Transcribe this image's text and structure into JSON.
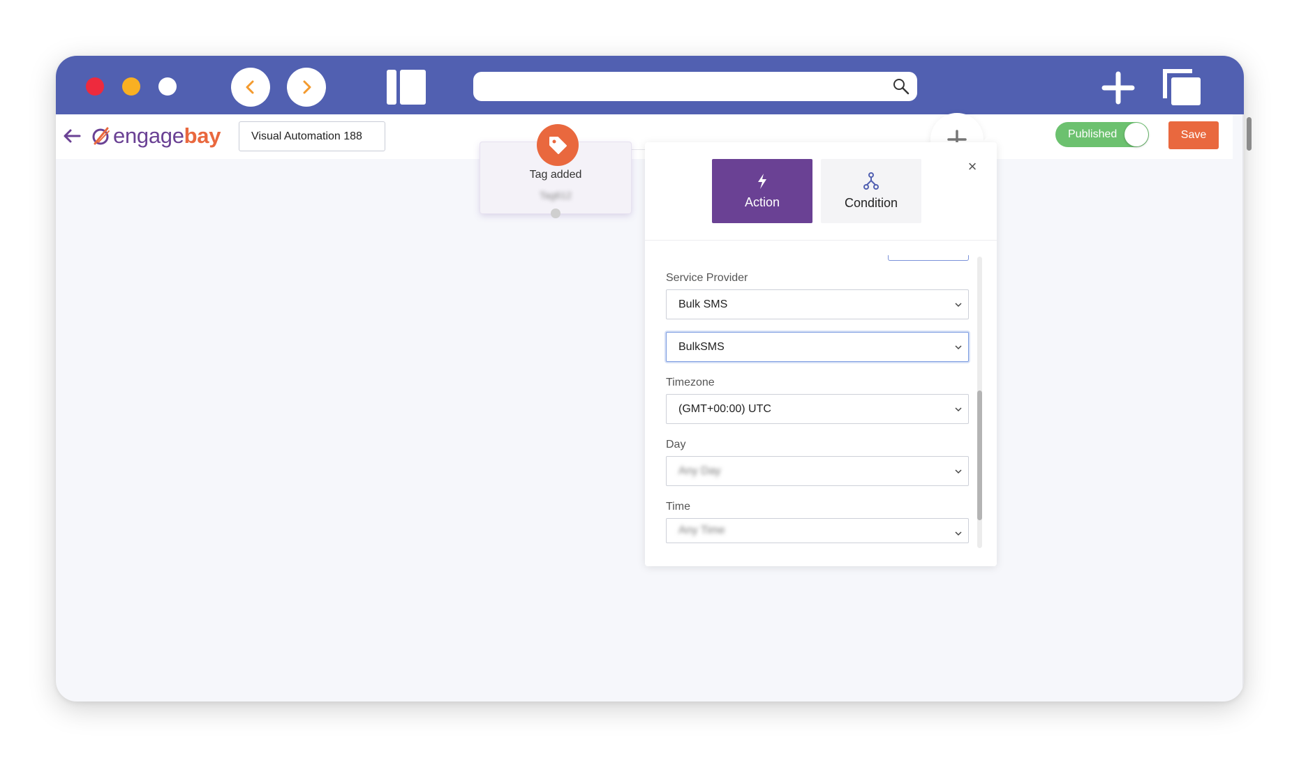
{
  "app": {
    "title": "Visual Automation 188",
    "logo_part1": "engage",
    "logo_part2": "bay",
    "status_label": "Published",
    "save_label": "Save"
  },
  "browser": {
    "url": "",
    "icons": [
      "close-dot",
      "minimize-dot",
      "maximize-dot",
      "back-icon",
      "forward-icon",
      "sidebar-icon",
      "search-icon",
      "plus-icon",
      "tabs-icon"
    ]
  },
  "trigger": {
    "title": "Tag added",
    "subtitle": "Tag612",
    "icon": "tag-icon"
  },
  "panel": {
    "tabs": [
      {
        "label": "Action",
        "icon": "lightning-icon",
        "active": true
      },
      {
        "label": "Condition",
        "icon": "branch-icon",
        "active": false
      }
    ],
    "fields": [
      {
        "label": "Service Provider",
        "value": "Bulk SMS"
      },
      {
        "label": "",
        "value": "BulkSMS"
      },
      {
        "label": "Timezone",
        "value": "(GMT+00:00) UTC"
      },
      {
        "label": "Day",
        "value": "Any Day"
      },
      {
        "label": "Time",
        "value": "Any Time"
      }
    ]
  },
  "colors": {
    "chrome": "#5160b1",
    "brand_purple": "#6a4194",
    "brand_orange": "#e9683e",
    "toggle_green": "#6cc16f"
  }
}
